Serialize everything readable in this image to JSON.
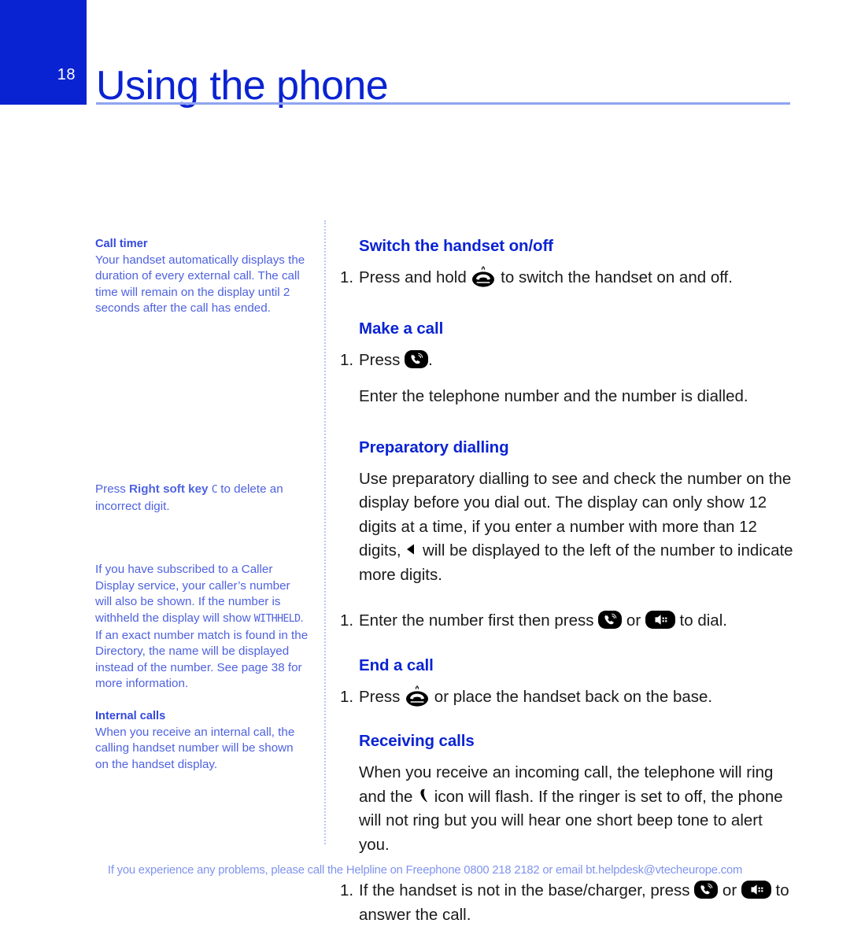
{
  "header": {
    "page_number": "18",
    "title": "Using the phone",
    "accent_color": "#0a23d2",
    "rule_color": "#8fa4f0"
  },
  "sidebar": {
    "blocks": [
      {
        "heading": "Call timer",
        "body": "Your handset automatically displays the duration of every external call. The call time will remain on the display until 2 seconds after the call has ended."
      },
      {
        "heading": "",
        "body_pre": "Press ",
        "body_bold": "Right soft key",
        "body_lcd": "C",
        "body_post": " to delete an incorrect digit."
      },
      {
        "heading": "",
        "body_pre": "If you have subscribed to a Caller Display service, your caller’s number will also be shown. If the number is withheld the display will show ",
        "body_lcd": "WITHHELD",
        "body_post": ". If an exact number match is found in the Directory, the name will be displayed instead of the number. See page 38 for more information."
      },
      {
        "heading": "Internal calls",
        "body": "When you receive an internal call, the calling handset number will be shown on the handset display."
      }
    ]
  },
  "main": {
    "sections": [
      {
        "heading": "Switch the handset on/off",
        "steps": [
          {
            "num": "1.",
            "pre": "Press and hold ",
            "icon": "end-call-power-icon",
            "post": " to switch the handset on and off."
          }
        ]
      },
      {
        "heading": "Make a call",
        "steps": [
          {
            "num": "1.",
            "pre": "Press ",
            "icon": "talk-handset-icon",
            "post": "."
          }
        ],
        "paragraphs": [
          "Enter the telephone number and the number is dialled."
        ]
      },
      {
        "heading": "Preparatory dialling",
        "paragraphs_before": [
          {
            "pre": "Use preparatory dialling to see and check the number on the display before you dial out. The display can only show 12 digits at a time, if you enter a number with more than 12 digits, ",
            "icon": "left-triangle-icon",
            "post": " will be displayed to the left of the number to indicate more digits."
          }
        ],
        "steps": [
          {
            "num": "1.",
            "pre": "Enter the number first then press ",
            "icon": "talk-handset-icon",
            "mid": " or ",
            "icon2": "speakerphone-icon",
            "post": " to dial."
          }
        ]
      },
      {
        "heading": "End a call",
        "steps": [
          {
            "num": "1.",
            "pre": "Press ",
            "icon": "end-call-power-icon",
            "post": " or place the handset back on the base."
          }
        ]
      },
      {
        "heading": "Receiving calls",
        "paragraphs_before": [
          {
            "pre": "When you receive an incoming call, the telephone will ring and the ",
            "icon": "handset-glyph-icon",
            "post": " icon will flash. If the ringer is set to off, the phone will not ring but you will hear one short beep tone to alert you."
          }
        ],
        "steps": [
          {
            "num": "1.",
            "pre": "If the handset is not in the base/charger, press ",
            "icon": "talk-handset-icon",
            "mid": " or ",
            "icon2": "speakerphone-icon",
            "post": " to answer the call."
          }
        ]
      }
    ]
  },
  "footer": {
    "text": "If you experience any problems, please call the Helpline on Freephone 0800 218 2182 or email bt.helpdesk@vtecheurope.com",
    "color": "#7f93ee"
  }
}
